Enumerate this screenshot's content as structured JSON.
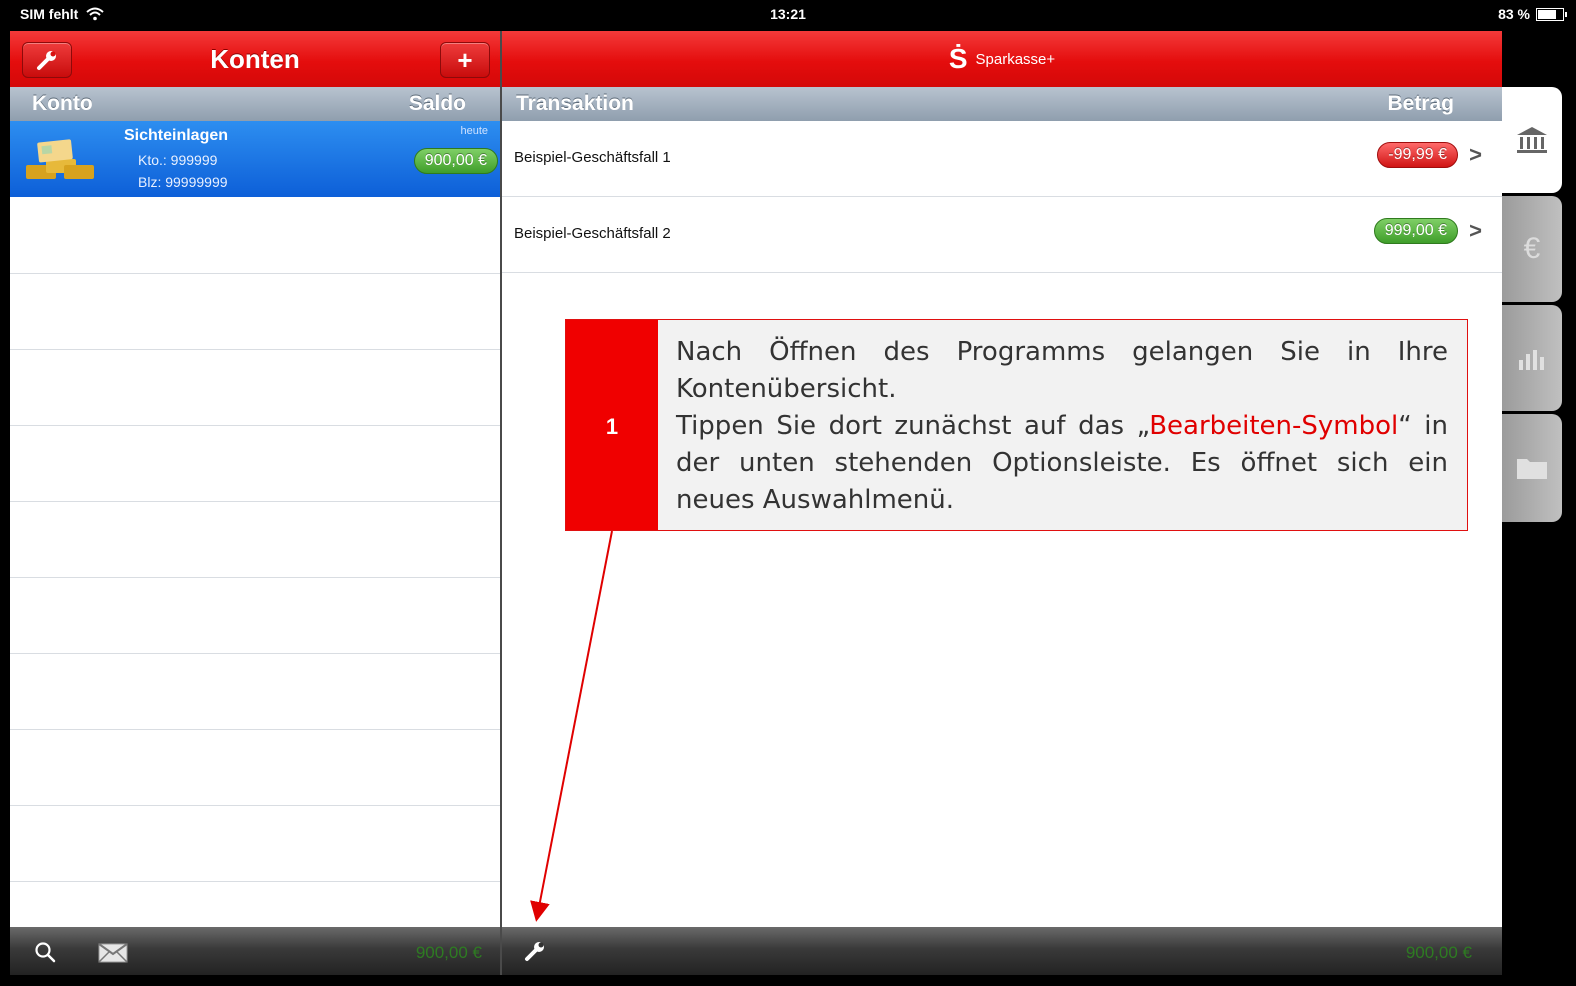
{
  "status_bar": {
    "carrier": "SIM fehlt",
    "time": "13:21",
    "battery": "83 %"
  },
  "left_panel": {
    "title": "Konten",
    "col_konto": "Konto",
    "col_saldo": "Saldo",
    "account": {
      "name": "Sichteinlagen",
      "kto": "Kto.: 999999",
      "blz": "Blz: 99999999",
      "date_label": "heute",
      "balance": "900,00 €"
    },
    "toolbar_total": "900,00 €"
  },
  "right_panel": {
    "brand": "Sparkasse+",
    "brand_symbol": "Ṡ",
    "col_transaktion": "Transaktion",
    "col_betrag": "Betrag",
    "transactions": [
      {
        "label": "Beispiel-Geschäftsfall 1",
        "amount": "-99,99 €",
        "color": "#d01414"
      },
      {
        "label": "Beispiel-Geschäftsfall 2",
        "amount": "999,00 €",
        "color": "#3f9e2a"
      }
    ],
    "toolbar_total": "900,00 €"
  },
  "side_tabs": [
    "bank-icon",
    "euro-transfer-icon",
    "chart-icon",
    "folder-icon"
  ],
  "annotation": {
    "number": "1",
    "text_1": "Nach Öffnen des Programms gelangen Sie in Ihre Kontenübersicht.",
    "text_2a": "Tippen Sie dort zunächst auf das „",
    "text_highlight": "Bearbeiten-Symbol",
    "text_2b": "“ in der unten stehenden Optionsleiste. Es öffnet sich ein neues Auswahlmenü.",
    "accent_color": "#e00000"
  }
}
